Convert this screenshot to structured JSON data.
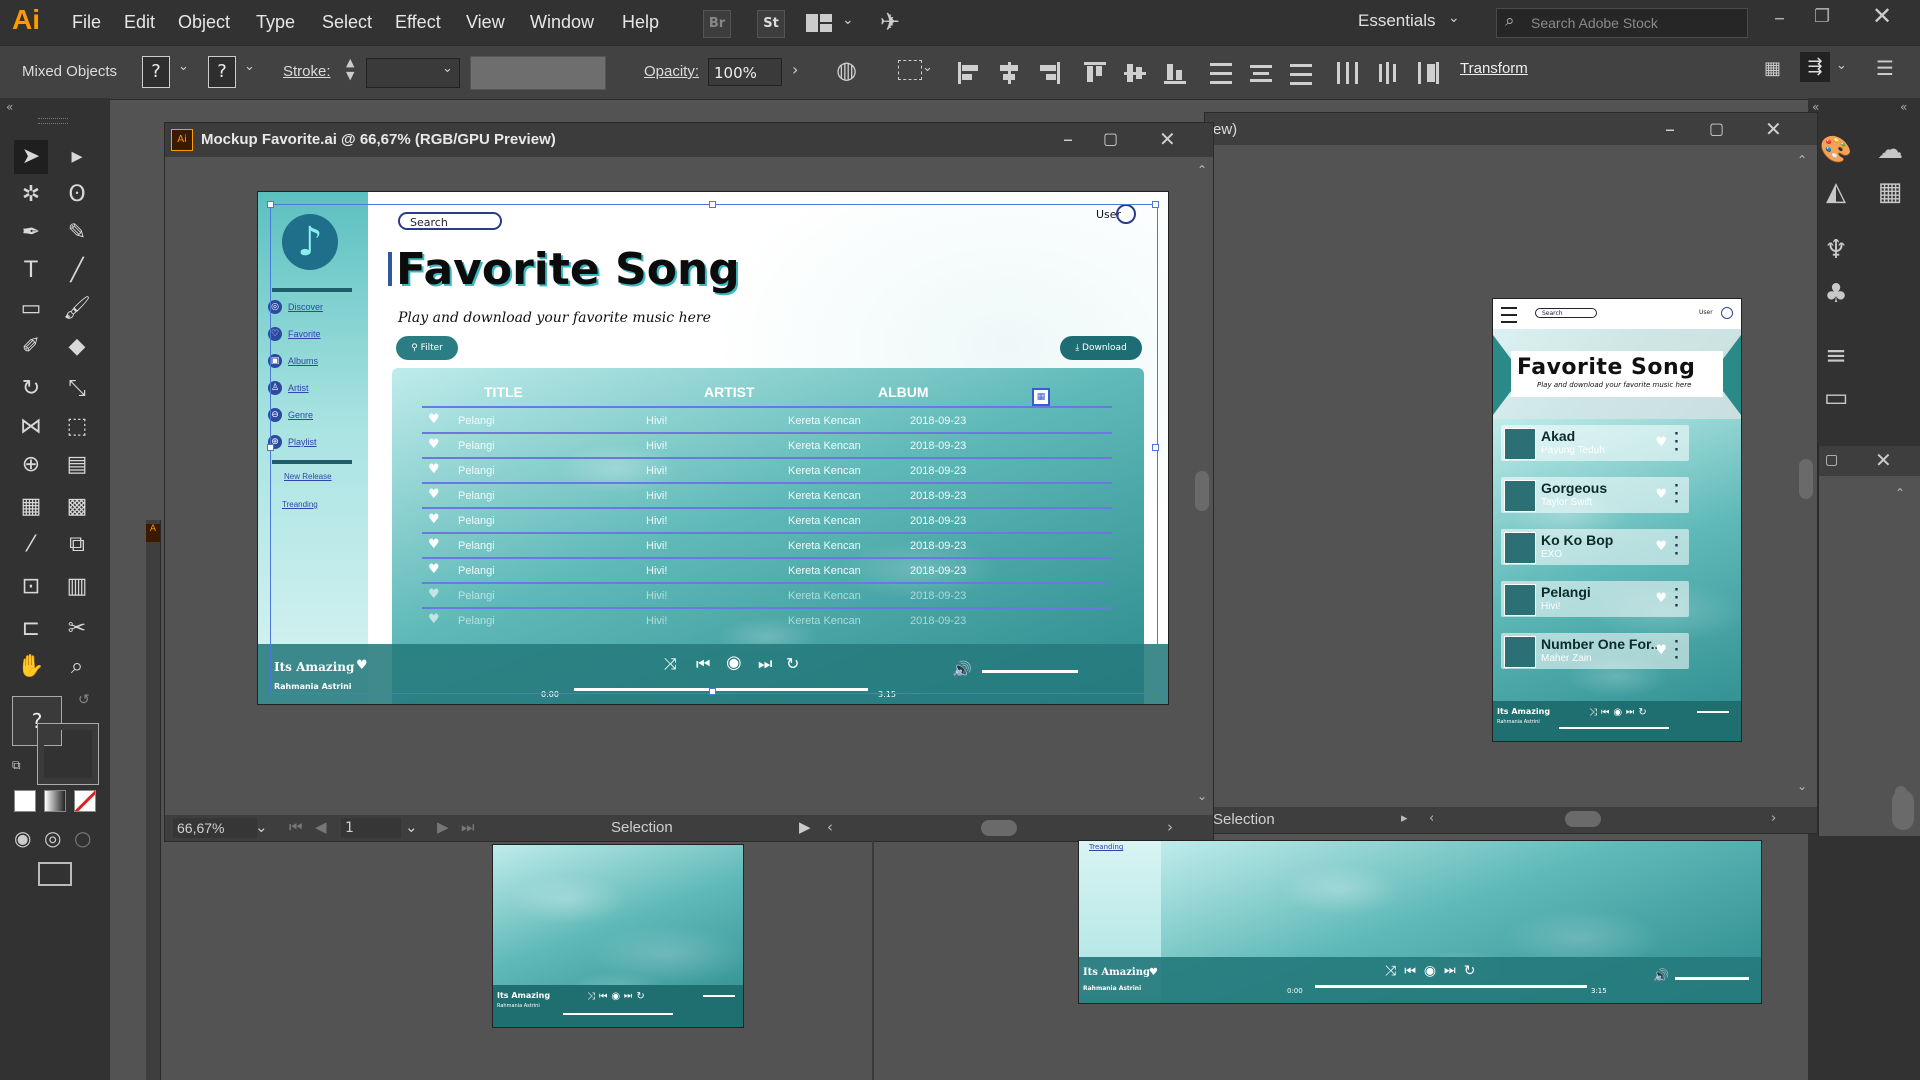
{
  "app": {
    "logo": "Ai",
    "menu": [
      "File",
      "Edit",
      "Object",
      "Type",
      "Select",
      "Effect",
      "View",
      "Window",
      "Help"
    ],
    "bridge_icon": "Br",
    "stock_icon": "St",
    "workspace": "Essentials",
    "search_placeholder": "Search Adobe Stock"
  },
  "control_bar": {
    "selection_label": "Mixed Objects",
    "fill_q": "?",
    "stroke_q": "?",
    "stroke_label": "Stroke:",
    "opacity_label": "Opacity:",
    "opacity_value": "100%",
    "transform_label": "Transform"
  },
  "document": {
    "title": "Mockup Favorite.ai @ 66,67% (RGB/GPU Preview)",
    "zoom": "66,67%",
    "page": "1",
    "status": "Selection",
    "second_title_fragment": "ew)",
    "second_status": "Selection",
    "swatch_q": "?"
  },
  "artboard": {
    "search": "Search",
    "user": "User",
    "heading": "Favorite Song",
    "subheading": "Play and download your favorite music here",
    "filter_btn": "Filter",
    "download_btn": "Download",
    "nav": [
      "Discover",
      "Favorite",
      "Albums",
      "Artist",
      "Genre",
      "Playlist"
    ],
    "nav2": [
      "New Release",
      "Treanding"
    ],
    "columns": [
      "TITLE",
      "ARTIST",
      "ALBUM"
    ],
    "rows": [
      {
        "title": "Pelangi",
        "artist": "Hivi!",
        "album": "Kereta Kencan",
        "date": "2018-09-23"
      },
      {
        "title": "Pelangi",
        "artist": "Hivi!",
        "album": "Kereta Kencan",
        "date": "2018-09-23"
      },
      {
        "title": "Pelangi",
        "artist": "Hivi!",
        "album": "Kereta Kencan",
        "date": "2018-09-23"
      },
      {
        "title": "Pelangi",
        "artist": "Hivi!",
        "album": "Kereta Kencan",
        "date": "2018-09-23"
      },
      {
        "title": "Pelangi",
        "artist": "Hivi!",
        "album": "Kereta Kencan",
        "date": "2018-09-23"
      },
      {
        "title": "Pelangi",
        "artist": "Hivi!",
        "album": "Kereta Kencan",
        "date": "2018-09-23"
      },
      {
        "title": "Pelangi",
        "artist": "Hivi!",
        "album": "Kereta Kencan",
        "date": "2018-09-23"
      },
      {
        "title": "Pelangi",
        "artist": "Hivi!",
        "album": "Kereta Kencan",
        "date": "2018-09-23"
      },
      {
        "title": "Pelangi",
        "artist": "Hivi!",
        "album": "Kereta Kencan",
        "date": "2018-09-23"
      }
    ],
    "now_playing": "Its Amazing",
    "now_artist": "Rahmania Astrini",
    "time_start": "0:00",
    "time_end": "3:15"
  },
  "mobile": {
    "search": "Search",
    "user": "User",
    "heading": "Favorite Song",
    "subheading": "Play and download your favorite music here",
    "songs": [
      {
        "title": "Akad",
        "artist": "Payung Teduh"
      },
      {
        "title": "Gorgeous",
        "artist": "Taylor Swift"
      },
      {
        "title": "Ko Ko Bop",
        "artist": "EXO"
      },
      {
        "title": "Pelangi",
        "artist": "Hivi!"
      },
      {
        "title": "Number One For..",
        "artist": "Maher Zain"
      }
    ],
    "now_playing": "Its Amazing",
    "now_artist": "Rahmania Astrini"
  },
  "bottom_boards": {
    "left_now": "Its Amazing",
    "left_artist": "Rahmania Astrini",
    "right_nav": "Treanding",
    "right_now": "Its Amazing",
    "right_artist": "Rahmania Astrini",
    "right_time_start": "0:00",
    "right_time_end": "3:15"
  }
}
